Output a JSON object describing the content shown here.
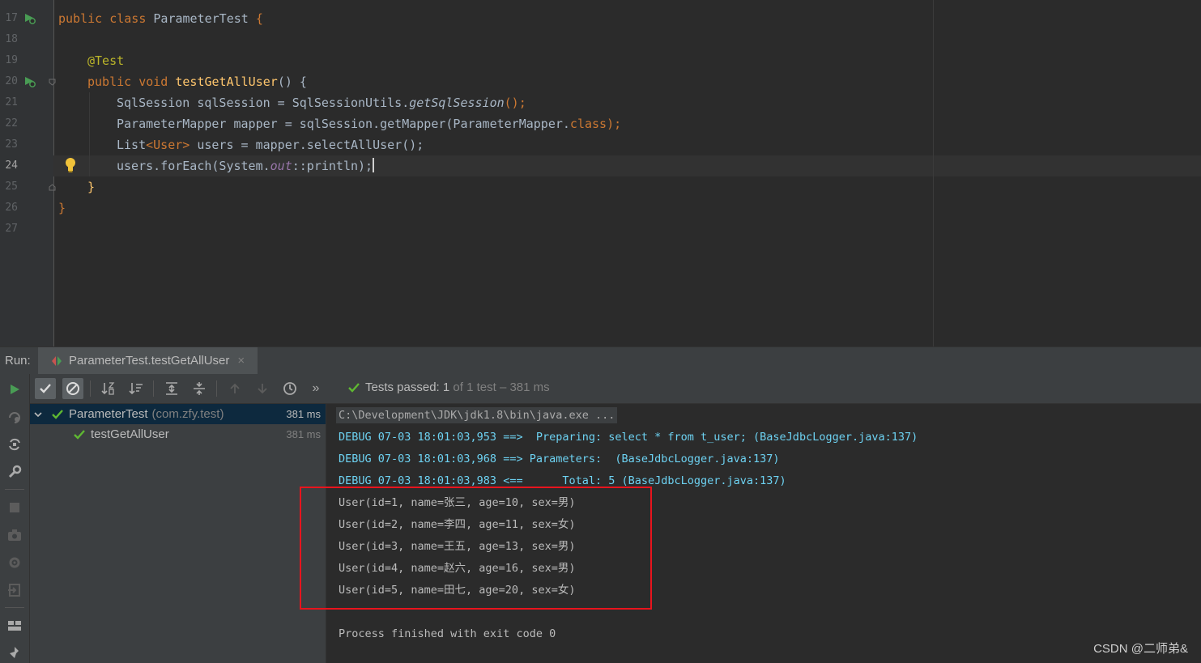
{
  "editor": {
    "line_numbers": [
      "17",
      "18",
      "19",
      "20",
      "21",
      "22",
      "23",
      "24",
      "25",
      "26",
      "27"
    ],
    "current_line": "24",
    "code": {
      "l17": {
        "kw1": "public",
        "kw2": "class",
        "name": "ParameterTest",
        "brace": "{"
      },
      "l19": {
        "annotation": "@Test"
      },
      "l20": {
        "kw1": "public",
        "kw2": "void",
        "method": "testGetAllUser",
        "rest": "() {"
      },
      "l21": {
        "a": "SqlSession sqlSession = SqlSessionUtils.",
        "b": "getSqlSession",
        "c": "();"
      },
      "l22": {
        "a": "ParameterMapper mapper = sqlSession.getMapper(ParameterMapper.",
        "b": "class",
        "c": ");"
      },
      "l23": {
        "a": "List",
        "b": "<User>",
        "c": " users = mapper.selectAllUser();"
      },
      "l24": {
        "a": "users.forEach(System.",
        "b": "out",
        "c": "::println);"
      },
      "l25": {
        "brace": "}"
      },
      "l26": {
        "brace": "}"
      }
    }
  },
  "run": {
    "label": "Run:",
    "tab_title": "ParameterTest.testGetAllUser",
    "tab_close": "×",
    "toolbar_more": "»",
    "status": {
      "prefix": "Tests passed:",
      "count": "1",
      "suffix_dim": "of 1 test – 381 ms"
    },
    "tree": [
      {
        "name": "ParameterTest",
        "package": "(com.zfy.test)",
        "time": "381 ms"
      },
      {
        "name": "testGetAllUser",
        "time": "381 ms"
      }
    ],
    "console": [
      "C:\\Development\\JDK\\jdk1.8\\bin\\java.exe ...",
      "DEBUG 07-03 18:01:03,953 ==>  Preparing: select * from t_user; (BaseJdbcLogger.java:137)",
      "DEBUG 07-03 18:01:03,968 ==> Parameters:  (BaseJdbcLogger.java:137)",
      "DEBUG 07-03 18:01:03,983 <==      Total: 5 (BaseJdbcLogger.java:137)",
      "User(id=1, name=张三, age=10, sex=男)",
      "User(id=2, name=李四, age=11, sex=女)",
      "User(id=3, name=王五, age=13, sex=男)",
      "User(id=4, name=赵六, age=16, sex=男)",
      "User(id=5, name=田七, age=20, sex=女)",
      "",
      "Process finished with exit code 0"
    ]
  },
  "watermark": "CSDN @二师弟&",
  "colors": {
    "keyword": "#cc7832",
    "annotation": "#bbb529",
    "method": "#ffc66d",
    "static_field": "#9876aa",
    "debug_text": "#6dd2f2",
    "pass_green": "#5fb832",
    "highlight_red": "#e8141d"
  }
}
